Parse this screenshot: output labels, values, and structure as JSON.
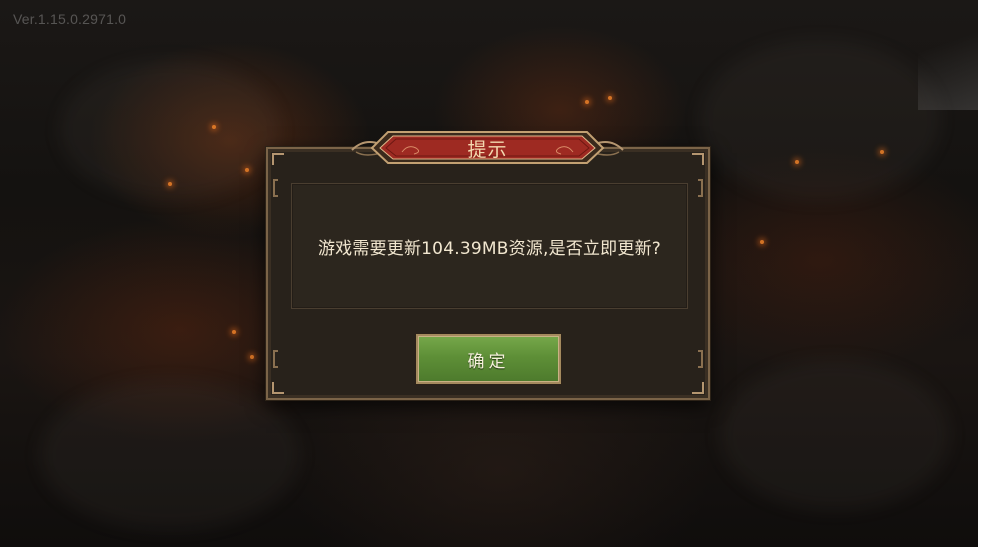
{
  "app": {
    "version_label": "Ver.1.15.0.2971.0"
  },
  "dialog": {
    "title": "提示",
    "message": "游戏需要更新104.39MB资源,是否立即更新?",
    "confirm_label": "确定"
  },
  "colors": {
    "dialog_background": "#28221b",
    "title_banner": "#9e2a22",
    "confirm_button": "#5e8f37",
    "message_text": "#f1e6cf"
  }
}
